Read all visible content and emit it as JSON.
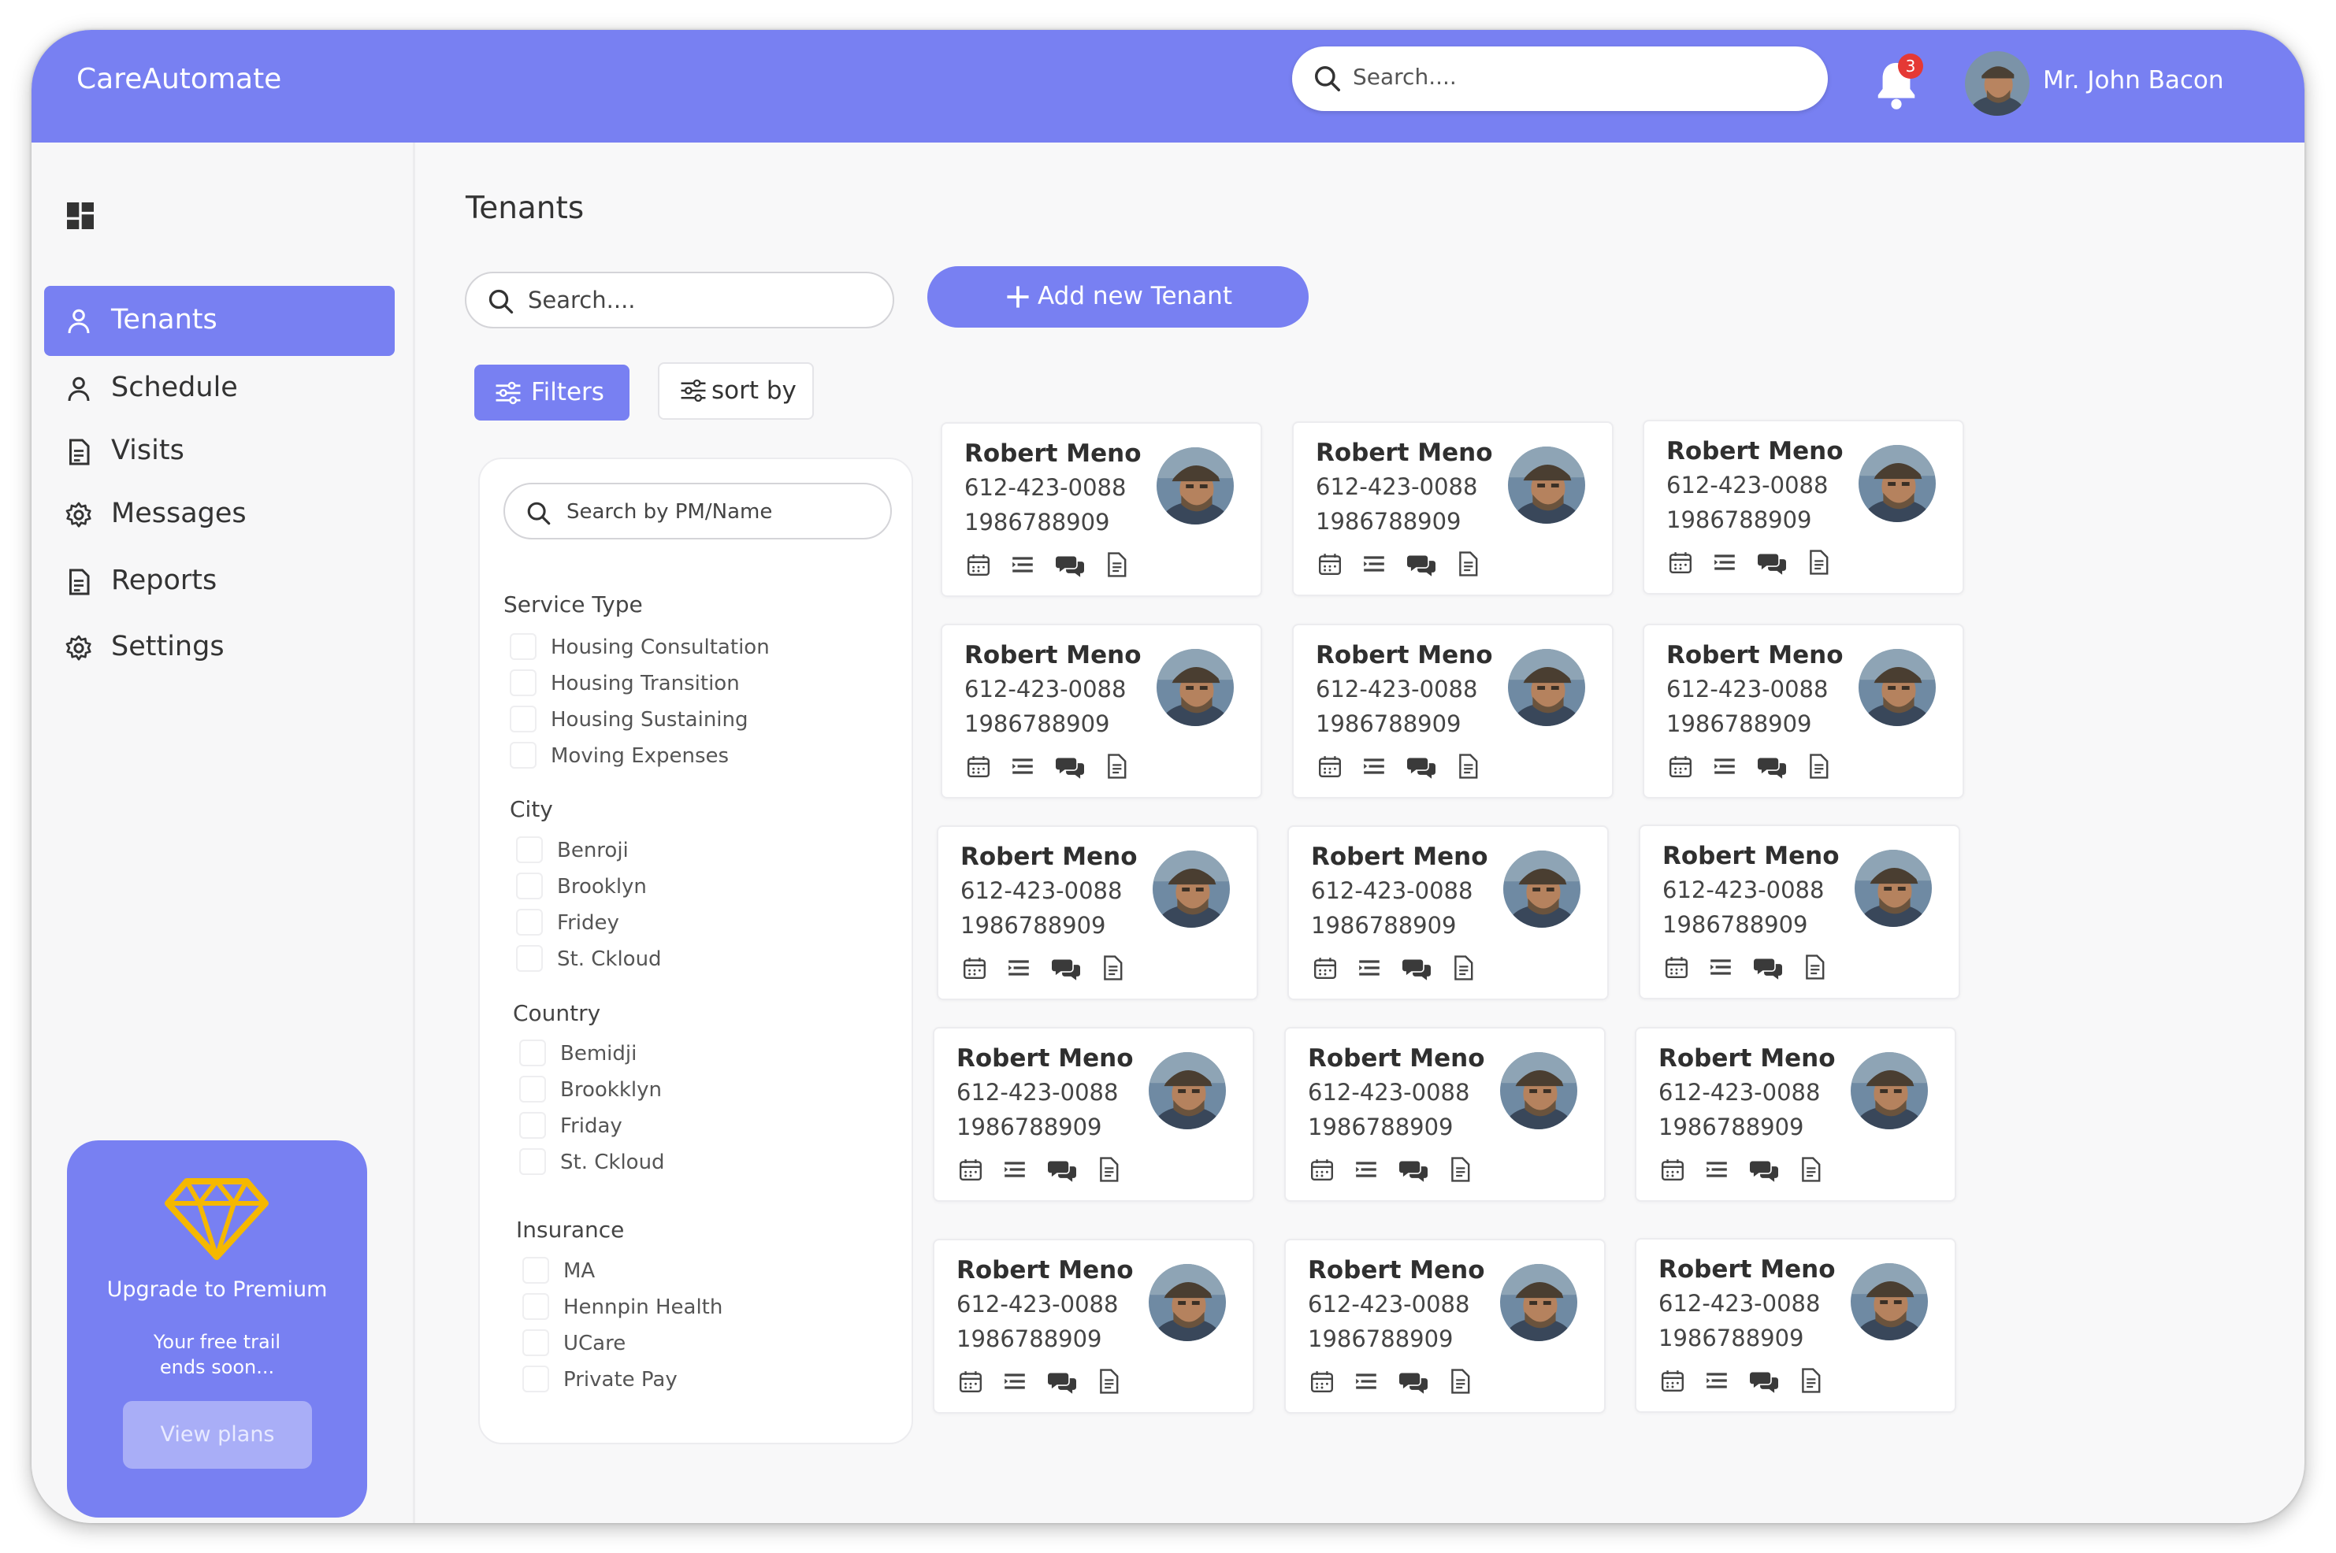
{
  "header": {
    "brand": "CareAutomate",
    "search_placeholder": "Search....",
    "notification_count": "3",
    "user_name": "Mr. John Bacon"
  },
  "sidebar": {
    "items": [
      {
        "label": "Tenants",
        "icon": "user-icon",
        "active": true
      },
      {
        "label": "Schedule",
        "icon": "user-icon",
        "active": false
      },
      {
        "label": "Visits",
        "icon": "document-icon",
        "active": false
      },
      {
        "label": "Messages",
        "icon": "gear-icon",
        "active": false
      },
      {
        "label": "Reports",
        "icon": "document-icon",
        "active": false
      },
      {
        "label": "Settings",
        "icon": "gear-icon",
        "active": false
      }
    ],
    "promo": {
      "title": "Upgrade to Premium",
      "subtitle_line1": "Your free trail",
      "subtitle_line2": "ends soon...",
      "button": "View plans"
    }
  },
  "main": {
    "title": "Tenants",
    "search_placeholder": "Search....",
    "add_button": "Add new Tenant",
    "filters_button": "Filters",
    "sort_button": "sort by"
  },
  "filters": {
    "search_placeholder": "Search by PM/Name",
    "sections": [
      {
        "title": "Service Type",
        "options": [
          "Housing Consultation",
          "Housing Transition",
          "Housing Sustaining",
          "Moving Expenses"
        ]
      },
      {
        "title": "City",
        "options": [
          "Benroji",
          "Brooklyn",
          "Fridey",
          "St. Ckloud"
        ]
      },
      {
        "title": "Country",
        "options": [
          "Bemidji",
          "Brookklyn",
          "Friday",
          "St. Ckloud"
        ]
      },
      {
        "title": "Insurance",
        "options": [
          "MA",
          "Hennpin Health",
          "UCare",
          "Private Pay"
        ]
      }
    ]
  },
  "tenants": [
    {
      "name": "Robert Meno",
      "phone": "612-423-0088",
      "id": "1986788909"
    },
    {
      "name": "Robert Meno",
      "phone": "612-423-0088",
      "id": "1986788909"
    },
    {
      "name": "Robert Meno",
      "phone": "612-423-0088",
      "id": "1986788909"
    },
    {
      "name": "Robert Meno",
      "phone": "612-423-0088",
      "id": "1986788909"
    },
    {
      "name": "Robert Meno",
      "phone": "612-423-0088",
      "id": "1986788909"
    },
    {
      "name": "Robert Meno",
      "phone": "612-423-0088",
      "id": "1986788909"
    },
    {
      "name": "Robert Meno",
      "phone": "612-423-0088",
      "id": "1986788909"
    },
    {
      "name": "Robert Meno",
      "phone": "612-423-0088",
      "id": "1986788909"
    },
    {
      "name": "Robert Meno",
      "phone": "612-423-0088",
      "id": "1986788909"
    },
    {
      "name": "Robert Meno",
      "phone": "612-423-0088",
      "id": "1986788909"
    },
    {
      "name": "Robert Meno",
      "phone": "612-423-0088",
      "id": "1986788909"
    },
    {
      "name": "Robert Meno",
      "phone": "612-423-0088",
      "id": "1986788909"
    },
    {
      "name": "Robert Meno",
      "phone": "612-423-0088",
      "id": "1986788909"
    },
    {
      "name": "Robert Meno",
      "phone": "612-423-0088",
      "id": "1986788909"
    },
    {
      "name": "Robert Meno",
      "phone": "612-423-0088",
      "id": "1986788909"
    }
  ],
  "card_action_icons": [
    "calendar-icon",
    "list-icon",
    "chat-icon",
    "document-icon"
  ],
  "colors": {
    "accent": "#7880f2",
    "promo_button": "#a9aef7",
    "badge": "#e53935",
    "gem": "#f5b800"
  }
}
